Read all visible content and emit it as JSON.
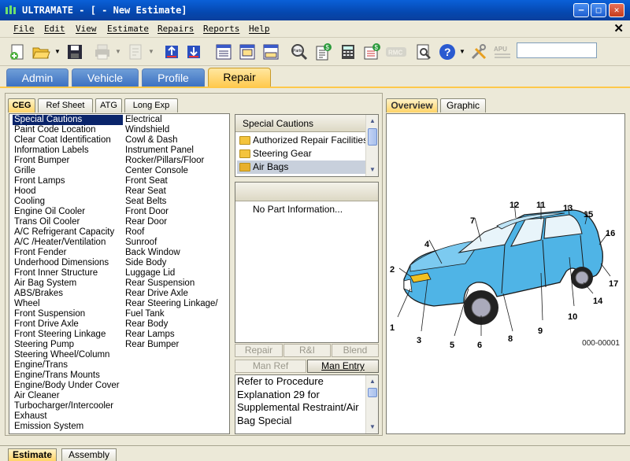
{
  "window": {
    "title": "ULTRAMATE - [ - New Estimate]",
    "min_glyph": "—",
    "max_glyph": "□",
    "close_glyph": "✕"
  },
  "menu": {
    "items": [
      "File",
      "Edit",
      "View",
      "Estimate",
      "Repairs",
      "Reports",
      "Help"
    ],
    "close_glyph": "✕"
  },
  "toolbar": {
    "labels": {
      "parts": "Parts",
      "rmc": "RMC",
      "apu": "APU"
    },
    "input_value": ""
  },
  "main_tabs": [
    {
      "label": "Admin",
      "active": false
    },
    {
      "label": "Vehicle",
      "active": false
    },
    {
      "label": "Profile",
      "active": false
    },
    {
      "label": "Repair",
      "active": true
    }
  ],
  "sub_tabs": [
    {
      "label": "CEG",
      "active": true
    },
    {
      "label": "Ref Sheet",
      "active": false
    },
    {
      "label": "ATG",
      "active": false
    },
    {
      "label": "Long Exp",
      "active": false
    }
  ],
  "ceg_list": {
    "selected": "Special Cautions",
    "column1": [
      "Special Cautions",
      "Paint Code Location",
      "Clear Coat Identification",
      "Information Labels",
      "Front Bumper",
      "Grille",
      "Front Lamps",
      "Hood",
      "Cooling",
      "Engine Oil Cooler",
      "Trans Oil Cooler",
      "A/C Refrigerant Capacity",
      "A/C /Heater/Ventilation",
      "Front Fender",
      "Underhood Dimensions",
      "Front Inner Structure",
      "Air Bag System",
      "ABS/Brakes",
      "Wheel",
      "Front Suspension",
      "Front Drive Axle",
      "Front Steering Linkage",
      "Steering Pump",
      "Steering Wheel/Column",
      "Engine/Trans",
      "Engine/Trans Mounts",
      "Engine/Body Under Cover",
      "Air Cleaner",
      "Turbocharger/Intercooler",
      "Exhaust",
      "Emission System"
    ],
    "column2": [
      "Electrical",
      "Windshield",
      "Cowl & Dash",
      "Instrument Panel",
      "Rocker/Pillars/Floor",
      "Center Console",
      "Front Seat",
      "Rear Seat",
      "Seat Belts",
      "Front Door",
      "Rear Door",
      "Roof",
      "Sunroof",
      "Back Window",
      "Side Body",
      "Luggage Lid",
      "Rear Suspension",
      "Rear Drive Axle",
      "Rear Steering Linkage/",
      "Fuel Tank",
      "Rear Body",
      "Rear Lamps",
      "Rear Bumper"
    ]
  },
  "cautions": {
    "header": "Special Cautions",
    "items": [
      "Authorized Repair Facilities",
      "Steering Gear",
      "Air Bags"
    ],
    "highlighted": "Air Bags"
  },
  "parts": {
    "empty_text": "No Part Information..."
  },
  "action_buttons": {
    "repair": "Repair",
    "rni": "R&I",
    "blend": "Blend",
    "man_ref": "Man Ref",
    "man_entry": "Man Entry"
  },
  "note": {
    "text": "Refer to Procedure Explanation 29 for Supplemental Restraint/Air Bag Special"
  },
  "view_tabs": [
    {
      "label": "Overview",
      "active": true
    },
    {
      "label": "Graphic",
      "active": false
    }
  ],
  "graphic": {
    "callouts": [
      "1",
      "2",
      "3",
      "4",
      "5",
      "6",
      "7",
      "8",
      "9",
      "10",
      "11",
      "12",
      "13",
      "14",
      "15",
      "16",
      "17"
    ],
    "figure_code": "000-00001",
    "car_color": "#4fb4e6"
  },
  "bottom_tabs": [
    {
      "label": "Estimate",
      "active": true
    },
    {
      "label": "Assembly",
      "active": false
    }
  ]
}
